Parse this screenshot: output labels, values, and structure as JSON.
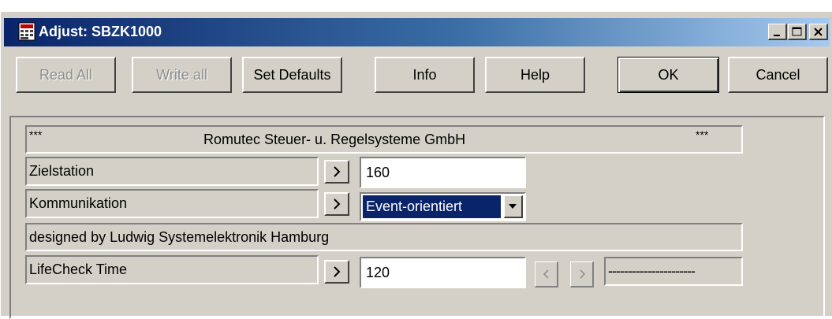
{
  "window": {
    "title": "Adjust: SBZK1000"
  },
  "toolbar": {
    "read_all": "Read All",
    "write_all": "Write all",
    "set_defaults": "Set Defaults",
    "info": "Info",
    "help": "Help",
    "ok": "OK",
    "cancel": "Cancel"
  },
  "header": {
    "left_marker": "***",
    "company": "Romutec Steuer- u. Regelsysteme GmbH",
    "right_marker": "***"
  },
  "rows": {
    "zielstation": {
      "label": "Zielstation",
      "value": "160"
    },
    "kommunikation": {
      "label": "Kommunikation",
      "value": "Event-orientiert"
    },
    "designed_by": "designed by Ludwig Systemelektronik Hamburg",
    "lifecheck": {
      "label": "LifeCheck Time",
      "value": "120",
      "readout": "----------------------"
    }
  },
  "icons": {
    "app": "calculator-icon",
    "minimize": "minimize-icon",
    "maximize": "maximize-icon",
    "close": "close-icon",
    "arrow_right": "chevron-right-icon",
    "arrow_left": "chevron-left-icon",
    "dropdown": "chevron-down-icon"
  },
  "colors": {
    "titlebar_start": "#0a246a",
    "titlebar_end": "#a6caf0",
    "face": "#d4d0c8",
    "selection": "#0a246a"
  }
}
